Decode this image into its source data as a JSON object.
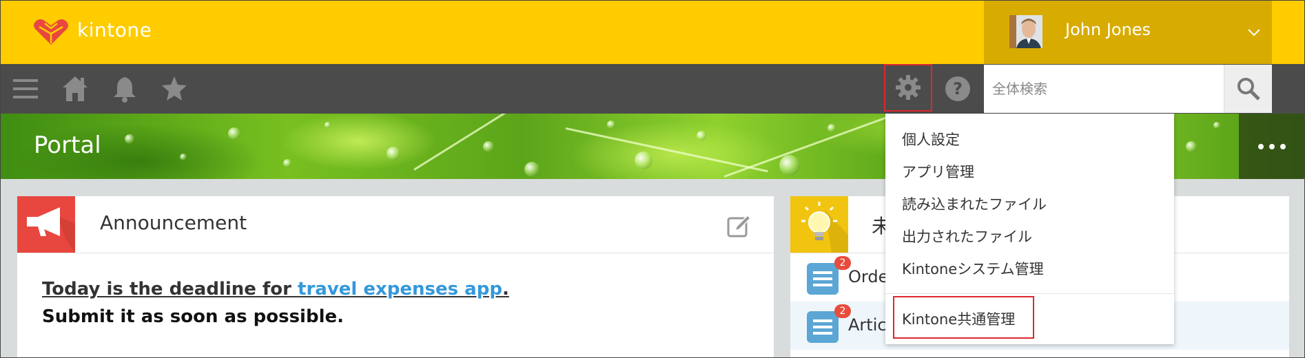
{
  "header": {
    "logo_text": "kintone",
    "user_name": "John Jones",
    "brand_color": "#ffcc00"
  },
  "toolbar": {
    "icons": [
      "menu-icon",
      "home-icon",
      "bell-icon",
      "star-icon",
      "gear-icon",
      "help-icon",
      "search-icon"
    ],
    "search_placeholder": "全体検索"
  },
  "banner": {
    "title": "Portal"
  },
  "announcement": {
    "title": "Announcement",
    "line1_prefix": "Today is the deadline for ",
    "line1_link": "travel expenses app",
    "line1_suffix": ".",
    "line2": "Submit it as soon as possible."
  },
  "right_panel": {
    "title_partial": "未",
    "rows": [
      {
        "label": "Orde",
        "badge": "2"
      },
      {
        "label": "Artic",
        "badge": "2"
      }
    ]
  },
  "settings_menu": {
    "items": [
      "個人設定",
      "アプリ管理",
      "読み込まれたファイル",
      "出力されたファイル",
      "Kintoneシステム管理"
    ],
    "highlighted_item": "Kintone共通管理"
  },
  "colors": {
    "highlight_border": "#e0262e",
    "link": "#3498db",
    "announcement_icon_bg": "#e8473f",
    "bulb_icon_bg": "#f1c40f",
    "badge": "#e74c3c"
  }
}
